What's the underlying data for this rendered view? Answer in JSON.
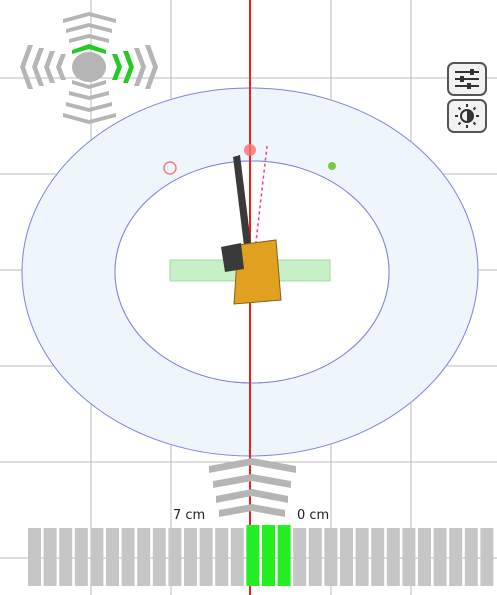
{
  "lightbar": {
    "left_offset_label": "7 cm",
    "right_offset_label": "0 cm",
    "segment_count": 30,
    "active_segments": [
      14,
      15,
      16
    ],
    "active_color": "#22ee22",
    "inactive_color": "#c6c6c6"
  },
  "colors": {
    "guidance_line": "#e82020",
    "grid_line": "#bbbbbb",
    "vehicle_body": "#e0a020",
    "implement": "#3a3a3a",
    "ring": "#8080e0",
    "ring_fill": "#eef6fc",
    "coverage_strip": "#c8f0c8",
    "direction_active": "#22cc22",
    "direction_inactive": "#b5b5b5"
  },
  "icons": {
    "settings": "sliders-icon",
    "display": "brightness-icon",
    "direction": "steering-arrows-icon",
    "straight": "chevron-up-stack-icon"
  }
}
